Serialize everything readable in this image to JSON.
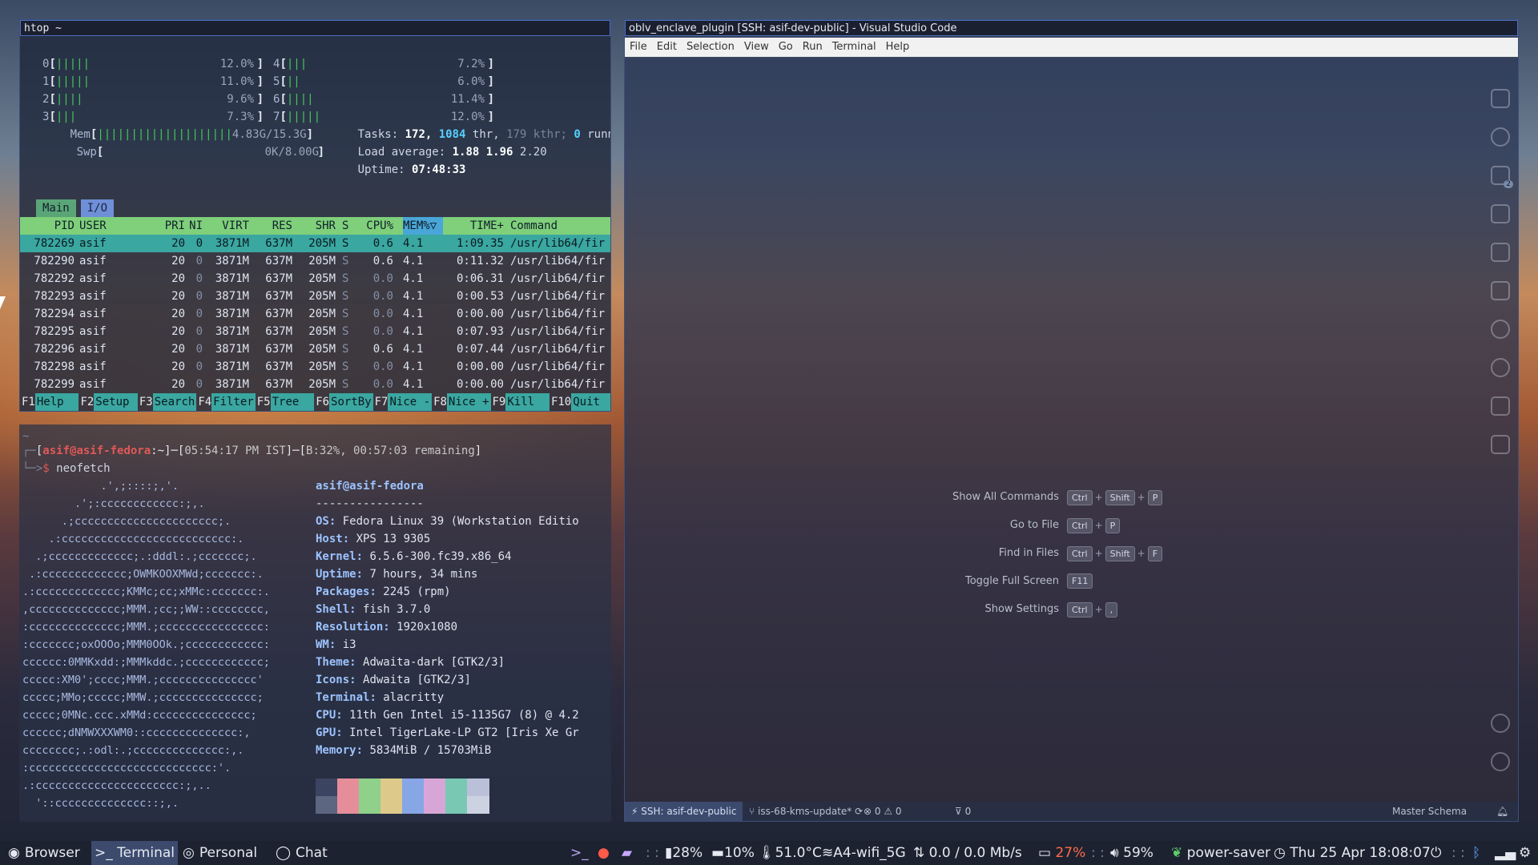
{
  "htop": {
    "title": "htop ~",
    "cpus": [
      {
        "id": "0",
        "bar": "|||||",
        "val": "12.0%"
      },
      {
        "id": "1",
        "bar": "|||||",
        "val": "11.0%"
      },
      {
        "id": "2",
        "bar": "||||",
        "val": "9.6%"
      },
      {
        "id": "3",
        "bar": "|||",
        "val": "7.3%"
      },
      {
        "id": "4",
        "bar": "|||",
        "val": "7.2%"
      },
      {
        "id": "5",
        "bar": "||",
        "val": "6.0%"
      },
      {
        "id": "6",
        "bar": "||||",
        "val": "11.4%"
      },
      {
        "id": "7",
        "bar": "|||||",
        "val": "12.0%"
      }
    ],
    "mem_label": "Mem",
    "mem_bar": "||||||||||||||||||||",
    "mem_val": "4.83G/15.3G",
    "swp_label": "Swp",
    "swp_val": "0K/8.00G",
    "tasks_label": "Tasks:",
    "tasks": "172,",
    "thr": "1084",
    "thr_label": "thr,",
    "kthr": "179 kthr;",
    "running": "0",
    "running_label": "runn",
    "load_label": "Load average:",
    "load1": "1.88",
    "load5": "1.96",
    "load15": "2.20",
    "uptime_label": "Uptime:",
    "uptime": "07:48:33",
    "tabs": [
      "Main",
      "I/O"
    ],
    "columns": [
      "PID",
      "USER",
      "PRI",
      "NI",
      "VIRT",
      "RES",
      "SHR",
      "S",
      "CPU%",
      "MEM%▽",
      "TIME+",
      "Command"
    ],
    "rows": [
      {
        "pid": "782269",
        "user": "asif",
        "pri": "20",
        "ni": "0",
        "virt": "3871M",
        "res": "637M",
        "shr": "205M",
        "s": "S",
        "cpu": "0.6",
        "mem": "4.1",
        "time": "1:09.35",
        "cmd": "/usr/lib64/fir"
      },
      {
        "pid": "782290",
        "user": "asif",
        "pri": "20",
        "ni": "0",
        "virt": "3871M",
        "res": "637M",
        "shr": "205M",
        "s": "S",
        "cpu": "0.6",
        "mem": "4.1",
        "time": "0:11.32",
        "cmd": "/usr/lib64/fir"
      },
      {
        "pid": "782292",
        "user": "asif",
        "pri": "20",
        "ni": "0",
        "virt": "3871M",
        "res": "637M",
        "shr": "205M",
        "s": "S",
        "cpu": "0.0",
        "mem": "4.1",
        "time": "0:06.31",
        "cmd": "/usr/lib64/fir"
      },
      {
        "pid": "782293",
        "user": "asif",
        "pri": "20",
        "ni": "0",
        "virt": "3871M",
        "res": "637M",
        "shr": "205M",
        "s": "S",
        "cpu": "0.0",
        "mem": "4.1",
        "time": "0:00.53",
        "cmd": "/usr/lib64/fir"
      },
      {
        "pid": "782294",
        "user": "asif",
        "pri": "20",
        "ni": "0",
        "virt": "3871M",
        "res": "637M",
        "shr": "205M",
        "s": "S",
        "cpu": "0.0",
        "mem": "4.1",
        "time": "0:00.00",
        "cmd": "/usr/lib64/fir"
      },
      {
        "pid": "782295",
        "user": "asif",
        "pri": "20",
        "ni": "0",
        "virt": "3871M",
        "res": "637M",
        "shr": "205M",
        "s": "S",
        "cpu": "0.0",
        "mem": "4.1",
        "time": "0:07.93",
        "cmd": "/usr/lib64/fir"
      },
      {
        "pid": "782296",
        "user": "asif",
        "pri": "20",
        "ni": "0",
        "virt": "3871M",
        "res": "637M",
        "shr": "205M",
        "s": "S",
        "cpu": "0.6",
        "mem": "4.1",
        "time": "0:07.44",
        "cmd": "/usr/lib64/fir"
      },
      {
        "pid": "782298",
        "user": "asif",
        "pri": "20",
        "ni": "0",
        "virt": "3871M",
        "res": "637M",
        "shr": "205M",
        "s": "S",
        "cpu": "0.0",
        "mem": "4.1",
        "time": "0:00.00",
        "cmd": "/usr/lib64/fir"
      },
      {
        "pid": "782299",
        "user": "asif",
        "pri": "20",
        "ni": "0",
        "virt": "3871M",
        "res": "637M",
        "shr": "205M",
        "s": "S",
        "cpu": "0.0",
        "mem": "4.1",
        "time": "0:00.00",
        "cmd": "/usr/lib64/fir"
      }
    ],
    "fkeys": [
      {
        "key": "F1",
        "label": "Help  "
      },
      {
        "key": "F2",
        "label": "Setup "
      },
      {
        "key": "F3",
        "label": "Search"
      },
      {
        "key": "F4",
        "label": "Filter"
      },
      {
        "key": "F5",
        "label": "Tree  "
      },
      {
        "key": "F6",
        "label": "SortBy"
      },
      {
        "key": "F7",
        "label": "Nice -"
      },
      {
        "key": "F8",
        "label": "Nice +"
      },
      {
        "key": "F9",
        "label": "Kill  "
      },
      {
        "key": "F10",
        "label": "Quit  "
      }
    ]
  },
  "terminal": {
    "tilde": "~",
    "prompt_user": "asif@asif-fedora",
    "prompt_dir": ":~",
    "prompt_time": "05:54:17 PM IST",
    "prompt_battery": "B:32%, 00:57:03 remaining",
    "command": "neofetch",
    "logo": [
      "            .',;::::;,'.",
      "        .';:cccccccccccc:;,.",
      "      .;cccccccccccccccccccccc;.",
      "    .:cccccccccccccccccccccccccc:.",
      "  .;ccccccccccccc;.:dddl:.;ccccccc;.",
      " .:ccccccccccccc;OWMKOOXMWd;ccccccc:.",
      ".:ccccccccccccc;KMMc;cc;xMMc:ccccccc:.",
      ",cccccccccccccc;MMM.;cc;;WW::cccccccc,",
      ":cccccccccccccc;MMM.;cccccccccccccccc:",
      ":ccccccc;oxOOOo;MMM0OOk.;cccccccccccc:",
      "cccccc:0MMKxdd:;MMMkddc.;cccccccccccc;",
      "ccccc:XM0';cccc;MMM.;ccccccccccccccc'",
      "ccccc;MMo;ccccc;MMW.;ccccccccccccccc;",
      "ccccc;0MNc.ccc.xMMd:ccccccccccccccc;",
      "cccccc;dNMWXXXWM0::cccccccccccccc:,",
      "cccccccc;.:odl:.;cccccccccccccc:,.",
      ":cccccccccccccccccccccccccccc:'.",
      ".:cccccccccccccccccccccc:;,..",
      "  '::cccccccccccccc::;,."
    ],
    "header": "asif@asif-fedora",
    "divider": "----------------",
    "info": [
      {
        "k": "OS",
        "v": "Fedora Linux 39 (Workstation Editio"
      },
      {
        "k": "Host",
        "v": "XPS 13 9305"
      },
      {
        "k": "Kernel",
        "v": "6.5.6-300.fc39.x86_64"
      },
      {
        "k": "Uptime",
        "v": "7 hours, 34 mins"
      },
      {
        "k": "Packages",
        "v": "2245 (rpm)"
      },
      {
        "k": "Shell",
        "v": "fish 3.7.0"
      },
      {
        "k": "Resolution",
        "v": "1920x1080"
      },
      {
        "k": "WM",
        "v": "i3"
      },
      {
        "k": "Theme",
        "v": "Adwaita-dark [GTK2/3]"
      },
      {
        "k": "Icons",
        "v": "Adwaita [GTK2/3]"
      },
      {
        "k": "Terminal",
        "v": "alacritty"
      },
      {
        "k": "CPU",
        "v": "11th Gen Intel i5-1135G7 (8) @ 4.2"
      },
      {
        "k": "GPU",
        "v": "Intel TigerLake-LP GT2 [Iris Xe Gr"
      },
      {
        "k": "Memory",
        "v": "5834MiB / 15703MiB"
      }
    ],
    "palette_top": [
      "#3b4460",
      "#e58e9a",
      "#8fd08a",
      "#ddc98a",
      "#86a6e6",
      "#d8a6d6",
      "#78c8b4",
      "#b9c0d8"
    ],
    "palette_bottom": [
      "#5c6680",
      "#e58e9a",
      "#8fd08a",
      "#ddc98a",
      "#86a6e6",
      "#d8a6d6",
      "#78c8b4",
      "#cdd2e2"
    ]
  },
  "vscode": {
    "title": "oblv_enclave_plugin [SSH: asif-dev-public] - Visual Studio Code",
    "menu": [
      "File",
      "Edit",
      "Selection",
      "View",
      "Go",
      "Run",
      "Terminal",
      "Help"
    ],
    "shortcuts": [
      {
        "label": "Show All Commands",
        "keys": [
          "Ctrl",
          "Shift",
          "P"
        ]
      },
      {
        "label": "Go to File",
        "keys": [
          "Ctrl",
          "P"
        ]
      },
      {
        "label": "Find in Files",
        "keys": [
          "Ctrl",
          "Shift",
          "F"
        ]
      },
      {
        "label": "Toggle Full Screen",
        "keys": [
          "F11"
        ]
      },
      {
        "label": "Show Settings",
        "keys": [
          "Ctrl",
          ","
        ]
      }
    ],
    "status": {
      "remote": "SSH: asif-dev-public",
      "branch": "iss-68-kms-update*",
      "errors": "0",
      "warnings": "0",
      "ports": "0",
      "schema": "Master Schema"
    },
    "source_control_badge": "2"
  },
  "taskbar": {
    "workspaces": [
      {
        "icon": "browser-icon",
        "label": "Browser"
      },
      {
        "icon": "terminal-icon",
        "label": ">_ Terminal"
      },
      {
        "icon": "chrome-icon",
        "label": "Personal"
      },
      {
        "icon": "chat-icon",
        "label": "Chat"
      }
    ],
    "prompt_glyph": ">_",
    "disk": "28%",
    "memory": "10%",
    "temperature": "51.0°C",
    "wifi": "A4-wifi_5G",
    "net_up": "0.0",
    "net_sep": "/",
    "net_down": "0.0 Mb/s",
    "battery": "27%",
    "volume": "59%",
    "power_profile": "power-saver",
    "datetime": "Thu 25 Apr 18:08:07",
    "colors": {
      "battery_low": "#ff6b4a",
      "accent": "#4c6fbf"
    }
  }
}
